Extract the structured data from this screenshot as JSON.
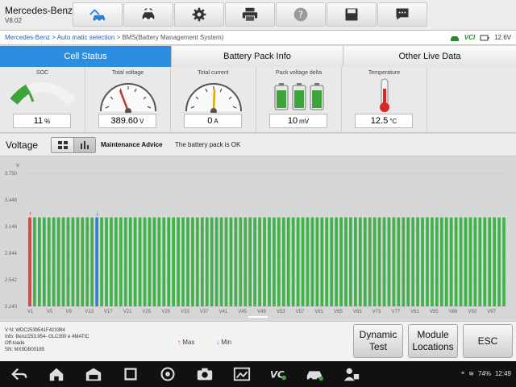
{
  "app": {
    "name": "Mercedes-Benz",
    "version": "V8.02"
  },
  "toolbar": {
    "items": [
      {
        "icon": "home-car-icon"
      },
      {
        "icon": "vehicle-switch-icon"
      },
      {
        "icon": "gear-icon"
      },
      {
        "icon": "printer-icon"
      },
      {
        "icon": "help-icon"
      },
      {
        "icon": "save-icon"
      },
      {
        "icon": "chat-icon"
      }
    ]
  },
  "breadcrumb": {
    "items": [
      "Mercedes-Benz",
      "Auto matic selection"
    ],
    "separator": ">",
    "current": "BMS(Battery Management System)"
  },
  "connection": {
    "vci_label": "VCI",
    "voltage": "12.6V"
  },
  "tabs": [
    "Cell Status",
    "Battery Pack Info",
    "Other Live Data"
  ],
  "active_tab": 0,
  "gauges": {
    "soc": {
      "label": "SOC",
      "value": "11",
      "unit": "%",
      "level": 0.11
    },
    "total_voltage": {
      "label": "Total voltage",
      "value": "389.60",
      "unit": "V"
    },
    "total_current": {
      "label": "Total current",
      "value": "0",
      "unit": "A"
    },
    "pack_delta": {
      "label": "Pack voltage delta",
      "value": "10",
      "unit": "mV"
    },
    "temperature": {
      "label": "Temperature",
      "value": "12.5",
      "unit": "°C"
    }
  },
  "voltage_section": {
    "title": "Voltage",
    "advice_label": "Maintenance Advice",
    "advice_text": "The battery pack is OK"
  },
  "chart_data": {
    "type": "bar",
    "ylabel": "V",
    "yticks": [
      "3.750",
      "3.448",
      "3.146",
      "2.844",
      "2.542",
      "2.240"
    ],
    "ylim": [
      2.24,
      3.75
    ],
    "xticks": [
      "V1",
      "V5",
      "V9",
      "V13",
      "V17",
      "V21",
      "V25",
      "V29",
      "V33",
      "V37",
      "V41",
      "V45",
      "V49",
      "V53",
      "V57",
      "V61",
      "V65",
      "V69",
      "V73",
      "V77",
      "V81",
      "V85",
      "V89",
      "V93",
      "V97"
    ],
    "cell_count": 100,
    "cell_voltage": 3.25,
    "max_cell": 1,
    "min_cell": 15,
    "colors": {
      "normal": "#3fb34a",
      "max": "#e04040",
      "min": "#2f7fd6"
    }
  },
  "vehicle_info": {
    "vin": "V N: WDC2539541F423384",
    "info": "Info: Benz/253.954- GLC350 e 4MATIC",
    "fuel": "Off-loade",
    "sn": "SN: MX9DB00185"
  },
  "legend": {
    "max": "Max",
    "min": "Min"
  },
  "actions": {
    "dynamic_test": "Dynamic Test",
    "module_locations": "Module Locations",
    "esc": "ESC"
  },
  "status": {
    "battery": "74%",
    "time": "12:49"
  }
}
